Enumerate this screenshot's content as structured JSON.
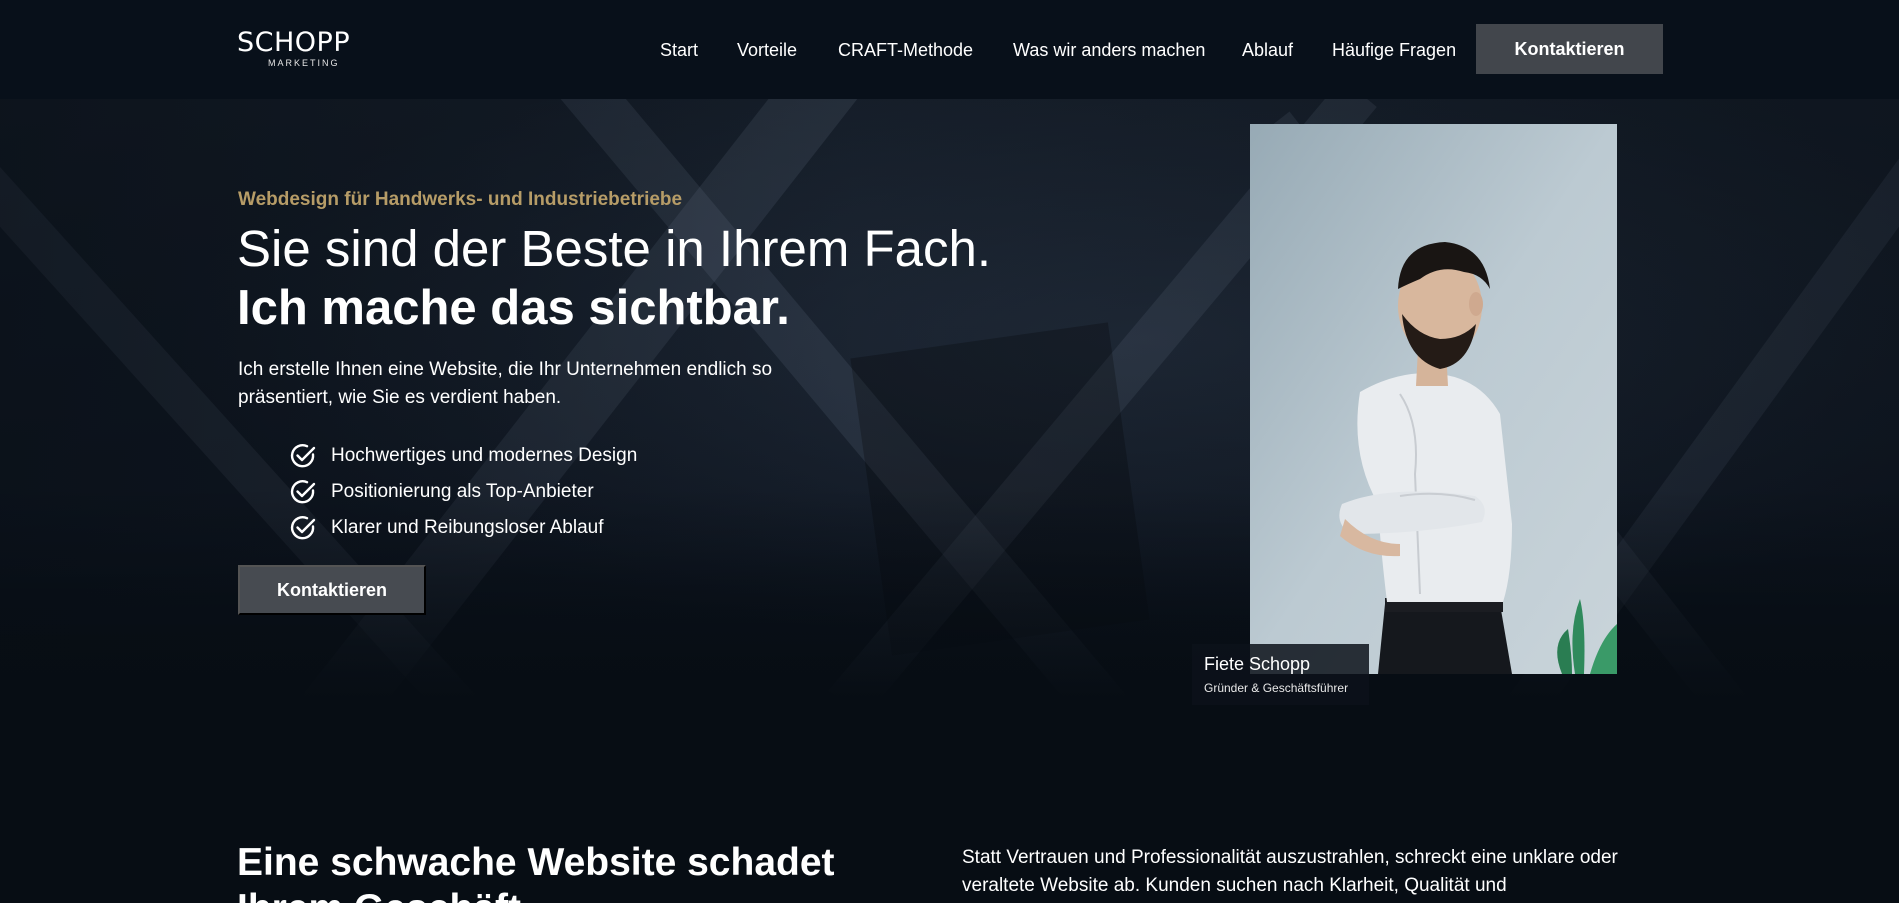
{
  "logo": {
    "wordmark": "SCHOPP",
    "subtitle": "MARKETING"
  },
  "nav": {
    "items": [
      "Start",
      "Vorteile",
      "CRAFT-Methode",
      "Was wir anders machen",
      "Ablauf",
      "Häufige Fragen"
    ],
    "cta_label": "Kontaktieren"
  },
  "hero": {
    "eyebrow": "Webdesign für Handwerks- und Industriebetriebe",
    "headline_line1": "Sie sind der Beste in Ihrem Fach.",
    "headline_line2": "Ich mache das sichtbar.",
    "intro": "Ich erstelle Ihnen eine Website, die Ihr Unternehmen endlich so präsentiert, wie Sie es verdient haben.",
    "benefits": [
      "Hochwertiges und modernes Design",
      "Positionierung als Top-Anbieter",
      "Klarer und Reibungsloser Ablauf"
    ],
    "cta_label": "Kontaktieren",
    "portrait_caption": {
      "name": "Fiete Schopp",
      "role": "Gründer & Geschäftsführer"
    }
  },
  "problem_section": {
    "title": "Eine schwache Website schadet Ihrem Geschäft",
    "text": "Statt Vertrauen und Professionalität auszustrahlen, schreckt eine unklare oder veraltete Website ab. Kunden suchen nach Klarheit, Qualität und"
  },
  "colors": {
    "background": "#070d14",
    "accent_gold": "#b69c67",
    "button": "#42464c"
  }
}
